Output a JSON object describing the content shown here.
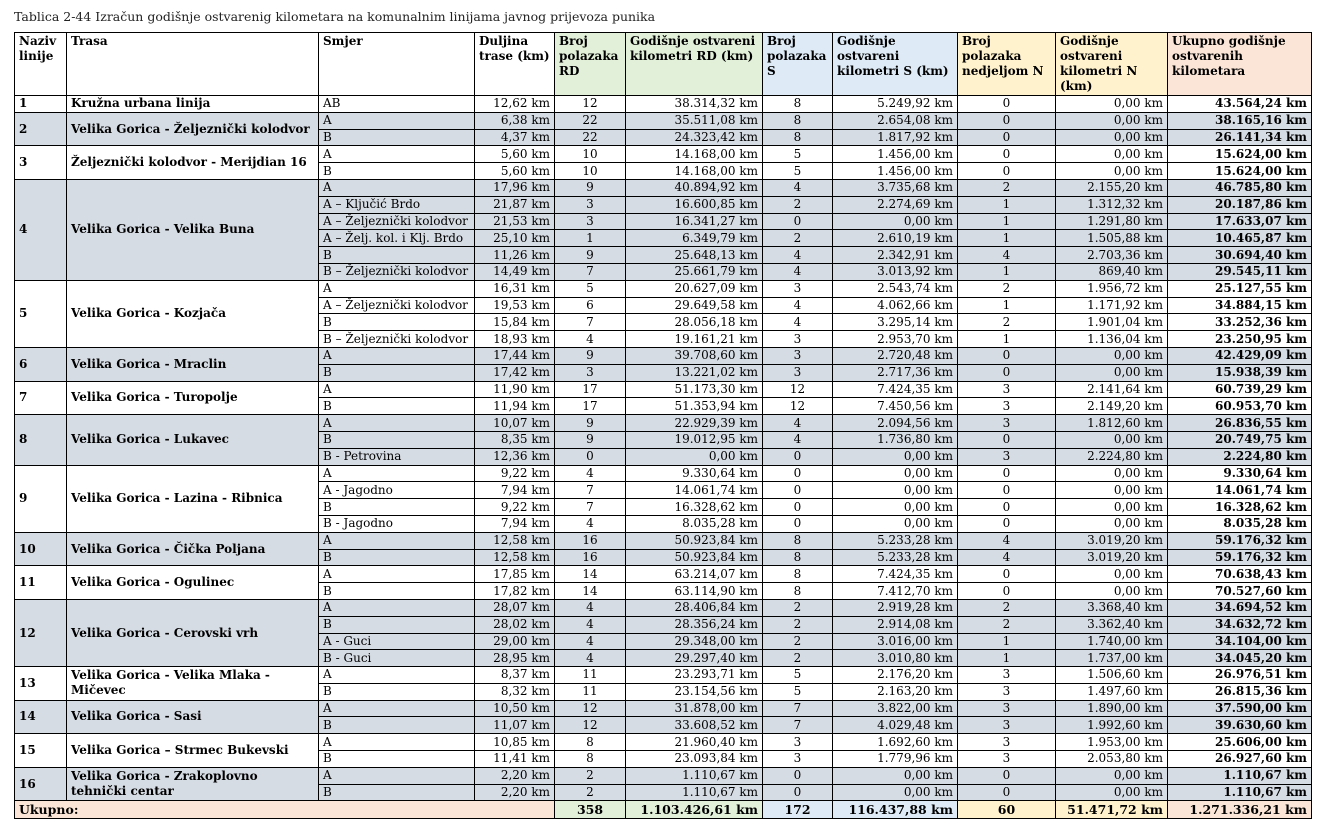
{
  "caption": "Tablica 2-44 Izračun godišnje ostvarenig kilometara na komunalnim linijama javnog prijevoza punika",
  "headers": [
    "Naziv linije",
    "Trasa",
    "Smjer",
    "Duljina trase (km)",
    "Broj polazaka RD",
    "Godišnje ostvareni kilometri RD (km)",
    "Broj polazaka S",
    "Godišnje ostvareni kilometri S (km)",
    "Broj polazaka nedjeljom N",
    "Godišnje ostvareni kilometri N (km)",
    "Ukupno godišnje ostvarenih kilometara"
  ],
  "header_colors": {
    "white": "#ffffff",
    "green": "#e2f0d9",
    "blue": "#deebf7",
    "yellow": "#fff2cc",
    "pink": "#fbe5d6",
    "gray": "#d6dce4"
  },
  "groups": [
    {
      "num": "1",
      "trasa": "Kružna urbana linija",
      "rows": [
        [
          "AB",
          "12,62 km",
          "12",
          "38.314,32 km",
          "8",
          "5.249,92 km",
          "0",
          "0,00 km",
          "43.564,24 km"
        ]
      ]
    },
    {
      "num": "2",
      "trasa": "Velika Gorica - Željeznički kolodvor",
      "rows": [
        [
          "A",
          "6,38 km",
          "22",
          "35.511,08 km",
          "8",
          "2.654,08 km",
          "0",
          "0,00 km",
          "38.165,16 km"
        ],
        [
          "B",
          "4,37 km",
          "22",
          "24.323,42 km",
          "8",
          "1.817,92 km",
          "0",
          "0,00 km",
          "26.141,34 km"
        ]
      ]
    },
    {
      "num": "3",
      "trasa": "Željeznički kolodvor - Merijdian 16",
      "rows": [
        [
          "A",
          "5,60 km",
          "10",
          "14.168,00 km",
          "5",
          "1.456,00 km",
          "0",
          "0,00 km",
          "15.624,00 km"
        ],
        [
          "B",
          "5,60 km",
          "10",
          "14.168,00 km",
          "5",
          "1.456,00 km",
          "0",
          "0,00 km",
          "15.624,00 km"
        ]
      ]
    },
    {
      "num": "4",
      "trasa": "Velika Gorica - Velika Buna",
      "rows": [
        [
          "A",
          "17,96 km",
          "9",
          "40.894,92 km",
          "4",
          "3.735,68 km",
          "2",
          "2.155,20 km",
          "46.785,80 km"
        ],
        [
          "A – Ključić Brdo",
          "21,87 km",
          "3",
          "16.600,85 km",
          "2",
          "2.274,69 km",
          "1",
          "1.312,32 km",
          "20.187,86 km"
        ],
        [
          "A – Željeznički kolodvor",
          "21,53 km",
          "3",
          "16.341,27 km",
          "0",
          "0,00 km",
          "1",
          "1.291,80 km",
          "17.633,07 km"
        ],
        [
          "A – Želj. kol. i Klj. Brdo",
          "25,10 km",
          "1",
          "6.349,79 km",
          "2",
          "2.610,19 km",
          "1",
          "1.505,88 km",
          "10.465,87 km"
        ],
        [
          "B",
          "11,26 km",
          "9",
          "25.648,13 km",
          "4",
          "2.342,91 km",
          "4",
          "2.703,36 km",
          "30.694,40 km"
        ],
        [
          "B –  Željeznički kolodvor",
          "14,49 km",
          "7",
          "25.661,79 km",
          "4",
          "3.013,92 km",
          "1",
          "869,40 km",
          "29.545,11 km"
        ]
      ]
    },
    {
      "num": "5",
      "trasa": "Velika Gorica - Kozjača",
      "rows": [
        [
          "A",
          "16,31 km",
          "5",
          "20.627,09 km",
          "3",
          "2.543,74 km",
          "2",
          "1.956,72 km",
          "25.127,55 km"
        ],
        [
          "A – Željeznički kolodvor",
          "19,53 km",
          "6",
          "29.649,58 km",
          "4",
          "4.062,66 km",
          "1",
          "1.171,92 km",
          "34.884,15 km"
        ],
        [
          "B",
          "15,84 km",
          "7",
          "28.056,18 km",
          "4",
          "3.295,14 km",
          "2",
          "1.901,04 km",
          "33.252,36 km"
        ],
        [
          "B – Željeznički kolodvor",
          "18,93 km",
          "4",
          "19.161,21 km",
          "3",
          "2.953,70 km",
          "1",
          "1.136,04 km",
          "23.250,95 km"
        ]
      ]
    },
    {
      "num": "6",
      "trasa": "Velika Gorica - Mraclin",
      "rows": [
        [
          "A",
          "17,44 km",
          "9",
          "39.708,60 km",
          "3",
          "2.720,48 km",
          "0",
          "0,00 km",
          "42.429,09 km"
        ],
        [
          "B",
          "17,42 km",
          "3",
          "13.221,02 km",
          "3",
          "2.717,36 km",
          "0",
          "0,00 km",
          "15.938,39 km"
        ]
      ]
    },
    {
      "num": "7",
      "trasa": "Velika Gorica - Turopolje",
      "rows": [
        [
          "A",
          "11,90 km",
          "17",
          "51.173,30 km",
          "12",
          "7.424,35 km",
          "3",
          "2.141,64 km",
          "60.739,29 km"
        ],
        [
          "B",
          "11,94 km",
          "17",
          "51.353,94 km",
          "12",
          "7.450,56 km",
          "3",
          "2.149,20 km",
          "60.953,70 km"
        ]
      ]
    },
    {
      "num": "8",
      "trasa": "Velika Gorica - Lukavec",
      "rows": [
        [
          "A",
          "10,07 km",
          "9",
          "22.929,39 km",
          "4",
          "2.094,56 km",
          "3",
          "1.812,60 km",
          "26.836,55 km"
        ],
        [
          "B",
          "8,35 km",
          "9",
          "19.012,95 km",
          "4",
          "1.736,80 km",
          "0",
          "0,00 km",
          "20.749,75 km"
        ],
        [
          "B - Petrovina",
          "12,36 km",
          "0",
          "0,00 km",
          "0",
          "0,00 km",
          "3",
          "2.224,80 km",
          "2.224,80 km"
        ]
      ]
    },
    {
      "num": "9",
      "trasa": "Velika Gorica - Lazina - Ribnica",
      "rows": [
        [
          "A",
          "9,22 km",
          "4",
          "9.330,64 km",
          "0",
          "0,00 km",
          "0",
          "0,00 km",
          "9.330,64 km"
        ],
        [
          "A - Jagodno",
          "7,94 km",
          "7",
          "14.061,74 km",
          "0",
          "0,00 km",
          "0",
          "0,00 km",
          "14.061,74 km"
        ],
        [
          "B",
          "9,22 km",
          "7",
          "16.328,62 km",
          "0",
          "0,00 km",
          "0",
          "0,00 km",
          "16.328,62 km"
        ],
        [
          "B - Jagodno",
          "7,94 km",
          "4",
          "8.035,28 km",
          "0",
          "0,00 km",
          "0",
          "0,00 km",
          "8.035,28 km"
        ]
      ]
    },
    {
      "num": "10",
      "trasa": "Velika Gorica - Čička Poljana",
      "rows": [
        [
          "A",
          "12,58 km",
          "16",
          "50.923,84 km",
          "8",
          "5.233,28 km",
          "4",
          "3.019,20 km",
          "59.176,32 km"
        ],
        [
          "B",
          "12,58 km",
          "16",
          "50.923,84 km",
          "8",
          "5.233,28 km",
          "4",
          "3.019,20 km",
          "59.176,32 km"
        ]
      ]
    },
    {
      "num": "11",
      "trasa": "Velika Gorica - Ogulinec",
      "rows": [
        [
          "A",
          "17,85 km",
          "14",
          "63.214,07 km",
          "8",
          "7.424,35 km",
          "0",
          "0,00 km",
          "70.638,43 km"
        ],
        [
          "B",
          "17,82 km",
          "14",
          "63.114,90 km",
          "8",
          "7.412,70 km",
          "0",
          "0,00 km",
          "70.527,60 km"
        ]
      ]
    },
    {
      "num": "12",
      "trasa": "Velika Gorica - Cerovski vrh",
      "rows": [
        [
          "A",
          "28,07 km",
          "4",
          "28.406,84 km",
          "2",
          "2.919,28 km",
          "2",
          "3.368,40 km",
          "34.694,52 km"
        ],
        [
          "B",
          "28,02 km",
          "4",
          "28.356,24 km",
          "2",
          "2.914,08 km",
          "2",
          "3.362,40 km",
          "34.632,72 km"
        ],
        [
          "A - Guci",
          "29,00 km",
          "4",
          "29.348,00 km",
          "2",
          "3.016,00 km",
          "1",
          "1.740,00 km",
          "34.104,00 km"
        ],
        [
          "B - Guci",
          "28,95 km",
          "4",
          "29.297,40 km",
          "2",
          "3.010,80 km",
          "1",
          "1.737,00 km",
          "34.045,20 km"
        ]
      ]
    },
    {
      "num": "13",
      "trasa": "Velika Gorica - Velika Mlaka - Mičevec",
      "rows": [
        [
          "A",
          "8,37 km",
          "11",
          "23.293,71 km",
          "5",
          "2.176,20 km",
          "3",
          "1.506,60 km",
          "26.976,51 km"
        ],
        [
          "B",
          "8,32 km",
          "11",
          "23.154,56 km",
          "5",
          "2.163,20 km",
          "3",
          "1.497,60 km",
          "26.815,36 km"
        ]
      ]
    },
    {
      "num": "14",
      "trasa": "Velika Gorica - Sasi",
      "rows": [
        [
          "A",
          "10,50 km",
          "12",
          "31.878,00 km",
          "7",
          "3.822,00 km",
          "3",
          "1.890,00 km",
          "37.590,00 km"
        ],
        [
          "B",
          "11,07 km",
          "12",
          "33.608,52 km",
          "7",
          "4.029,48 km",
          "3",
          "1.992,60 km",
          "39.630,60 km"
        ]
      ]
    },
    {
      "num": "15",
      "trasa": "Velika Gorica – Strmec Bukevski",
      "rows": [
        [
          "A",
          "10,85 km",
          "8",
          "21.960,40 km",
          "3",
          "1.692,60 km",
          "3",
          "1.953,00 km",
          "25.606,00 km"
        ],
        [
          "B",
          "11,41 km",
          "8",
          "23.093,84 km",
          "3",
          "1.779,96 km",
          "3",
          "2.053,80 km",
          "26.927,60 km"
        ]
      ]
    },
    {
      "num": "16",
      "trasa": "Velika Gorica - Zrakoplovno tehnički centar",
      "rows": [
        [
          "A",
          "2,20 km",
          "2",
          "1.110,67 km",
          "0",
          "0,00 km",
          "0",
          "0,00 km",
          "1.110,67 km"
        ],
        [
          "B",
          "2,20 km",
          "2",
          "1.110,67 km",
          "0",
          "0,00 km",
          "0",
          "0,00 km",
          "1.110,67 km"
        ]
      ]
    }
  ],
  "total": {
    "label": "Ukupno:",
    "rd": "358",
    "km_rd": "1.103.426,61 km",
    "s": "172",
    "km_s": "116.437,88 km",
    "n": "60",
    "km_n": "51.471,72 km",
    "sum": "1.271.336,21 km"
  }
}
